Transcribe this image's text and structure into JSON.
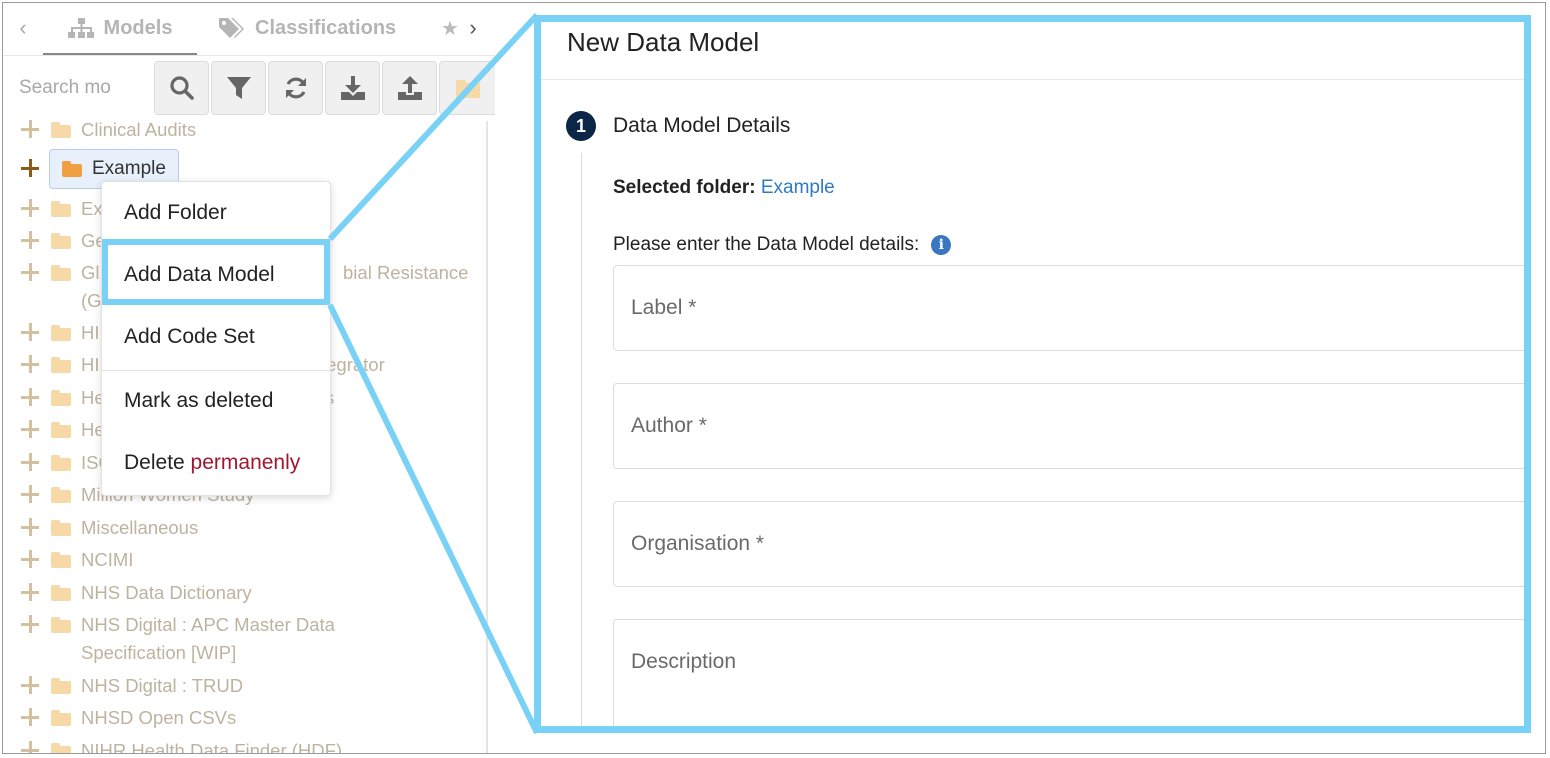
{
  "tabs": {
    "models": "Models",
    "classifications": "Classifications"
  },
  "search": {
    "placeholder": "Search mo"
  },
  "toolbar": {
    "icons": [
      "search-icon",
      "filter-icon",
      "refresh-icon",
      "download-icon",
      "upload-icon",
      "folder-icon"
    ]
  },
  "tree": {
    "items": [
      "Clinical Audits",
      "Example",
      "Ex",
      "Ge",
      "Gl",
      "bial Resistance",
      "(G",
      "HI",
      "HI",
      "tegrator",
      "He",
      "s",
      "He",
      "ISC",
      "Million Women Study",
      "Miscellaneous",
      "NCIMI",
      "NHS Data Dictionary",
      "NHS Digital : APC Master Data Specification [WIP]",
      "NHS Digital : TRUD",
      "NHSD Open CSVs",
      "NIHR Health Data Finder (HDF)"
    ]
  },
  "context_menu": {
    "add_folder": "Add Folder",
    "add_data_model": "Add Data Model",
    "add_code_set": "Add Code Set",
    "mark_deleted": "Mark as deleted",
    "delete_prefix": "Delete",
    "delete_suffix": "permanenly"
  },
  "form": {
    "title": "New Data Model",
    "step_number": "1",
    "step_title": "Data Model Details",
    "selected_folder_label": "Selected folder:",
    "selected_folder_value": "Example",
    "instructions": "Please enter the Data Model details:",
    "info_glyph": "i",
    "fields": {
      "label": "Label *",
      "author": "Author *",
      "organisation": "Organisation *",
      "description": "Description"
    }
  },
  "colors": {
    "highlight": "#79d2f6",
    "step_badge": "#0b2647",
    "link": "#2f7bbf",
    "danger": "#a01830"
  }
}
